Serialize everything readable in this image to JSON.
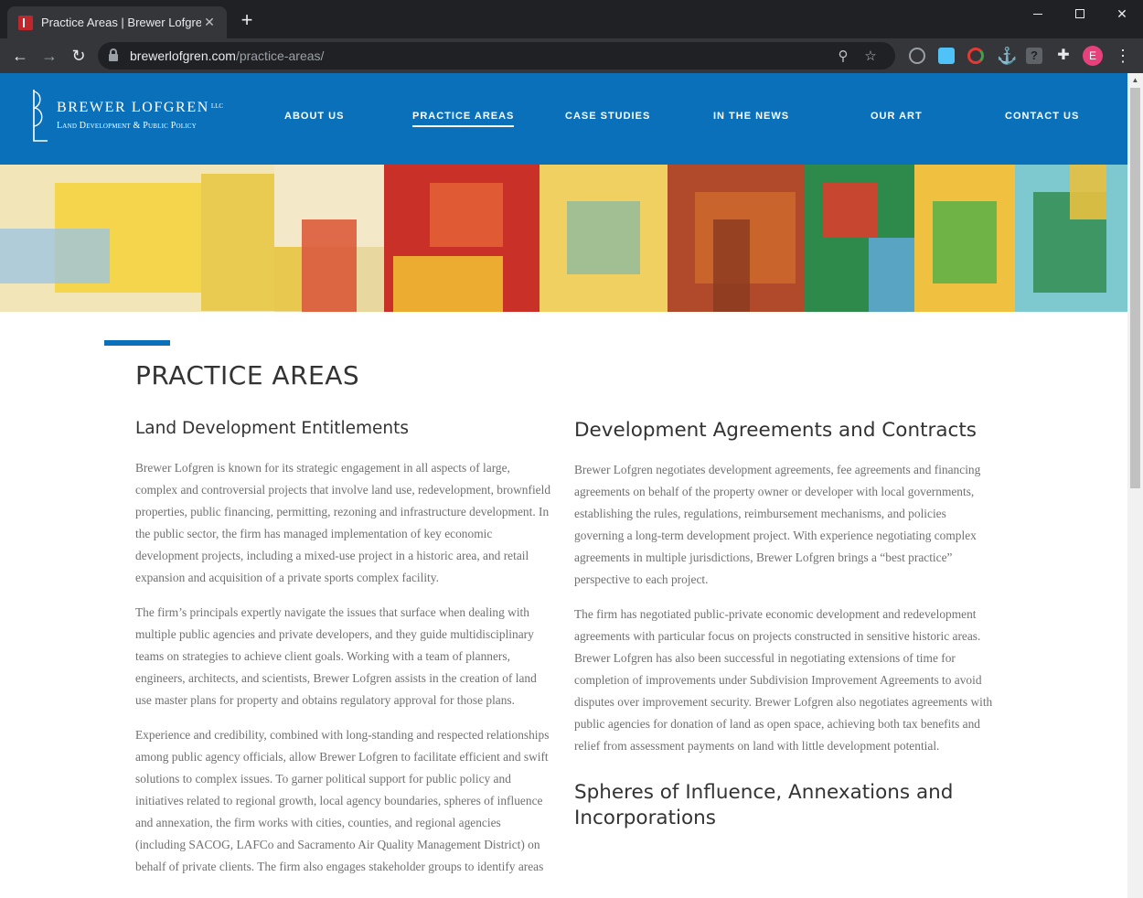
{
  "browser": {
    "tab_title": "Practice Areas | Brewer Lofgren",
    "tab_close": "✕",
    "new_tab": "+",
    "url_domain": "brewerlofgren.com",
    "url_path": "/practice-areas/",
    "avatar_letter": "E"
  },
  "site": {
    "logo_name": "Brewer Lofgren",
    "logo_suffix": "LLC",
    "logo_tagline": "Land Development & Public Policy",
    "nav": [
      {
        "label": "ABOUT US"
      },
      {
        "label": "PRACTICE AREAS",
        "active": true
      },
      {
        "label": "CASE STUDIES"
      },
      {
        "label": "IN THE NEWS"
      },
      {
        "label": "OUR ART"
      },
      {
        "label": "CONTACT US"
      }
    ],
    "brand_color": "#0a70ba"
  },
  "page": {
    "title": "PRACTICE AREAS",
    "left": {
      "heading": "Land Development Entitlements",
      "paragraphs": [
        "Brewer Lofgren is known for its strategic engagement in all aspects of large, complex and controversial projects that involve land use, redevelopment, brownfield properties, public financing, permitting, rezoning and infrastructure development. In the public sector, the firm has managed implementation of key economic development projects, including a mixed-use project in a historic area, and retail expansion and acquisition of a private sports complex facility.",
        "The firm’s principals expertly navigate the issues that surface when dealing with multiple public agencies and private developers, and they guide multidisciplinary teams on strategies to achieve client goals. Working with a team of planners, engineers, architects, and scientists, Brewer Lofgren assists in the creation of land use master plans for property and obtains regulatory approval for those plans.",
        "Experience and credibility, combined with long-standing and respected relationships among public agency officials, allow Brewer Lofgren to facilitate efficient and swift solutions to complex issues. To garner political support for public policy and initiatives related to regional growth, local agency boundaries, spheres of influence and annexation, the firm works with cities, counties, and regional agencies (including SACOG, LAFCo and Sacramento Air Quality Management District) on behalf of private clients. The firm also engages stakeholder groups to identify areas"
      ]
    },
    "right": {
      "heading": "Development Agreements and Contracts",
      "paragraphs": [
        "Brewer Lofgren negotiates development agreements, fee agreements and financing agreements on behalf of the property owner or developer with local governments, establishing the rules, regulations, reimbursement mechanisms, and policies governing a long-term development project. With experience negotiating complex agreements in multiple jurisdictions, Brewer Lofgren brings a “best practice” perspective to each project.",
        "The firm has negotiated public-private economic development and redevelopment agreements with particular focus on projects constructed in sensitive historic areas. Brewer Lofgren has also been successful in negotiating extensions of time for completion of improvements under Subdivision Improvement Agreements to avoid disputes over improvement security.  Brewer Lofgren also negotiates agreements with public agencies for donation of land as open space, achieving both tax benefits and relief from assessment payments on land with little development potential."
      ],
      "subheading": "Spheres of Influence, Annexations and Incorporations"
    }
  }
}
